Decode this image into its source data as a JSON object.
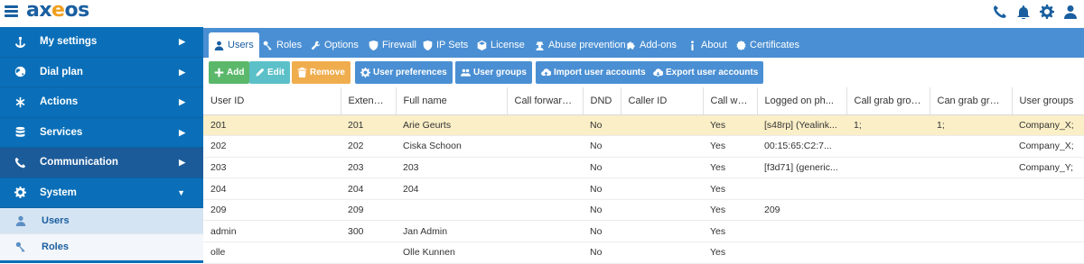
{
  "app": {
    "logo_main": "ax",
    "logo_accent": "e",
    "logo_rest": "os"
  },
  "sidebar": {
    "items": [
      {
        "label": "My settings",
        "icon": "anchor-icon"
      },
      {
        "label": "Dial plan",
        "icon": "globe-icon"
      },
      {
        "label": "Actions",
        "icon": "asterisk-icon"
      },
      {
        "label": "Services",
        "icon": "database-icon"
      },
      {
        "label": "Communication",
        "icon": "phone-icon"
      },
      {
        "label": "System",
        "icon": "gear-icon"
      }
    ],
    "subitems": [
      {
        "label": "Users",
        "icon": "users-icon"
      },
      {
        "label": "Roles",
        "icon": "key-icon"
      }
    ]
  },
  "tabs": [
    {
      "label": "Users"
    },
    {
      "label": "Roles"
    },
    {
      "label": "Options"
    },
    {
      "label": "Firewall"
    },
    {
      "label": "IP Sets"
    },
    {
      "label": "License"
    },
    {
      "label": "Abuse prevention"
    },
    {
      "label": "Add-ons"
    },
    {
      "label": "About"
    },
    {
      "label": "Certificates"
    }
  ],
  "toolbar": {
    "add": "Add",
    "edit": "Edit",
    "remove": "Remove",
    "user_preferences": "User preferences",
    "user_groups": "User groups",
    "import": "Import user accounts",
    "export": "Export user accounts"
  },
  "table": {
    "headers": [
      "User ID",
      "Extension",
      "Full name",
      "Call forwarding",
      "DND",
      "Caller ID",
      "Call waiting",
      "Logged on ph...",
      "Call grab group",
      "Can grab group",
      "User groups"
    ],
    "rows": [
      [
        "201",
        "201",
        "Arie Geurts",
        "",
        "No",
        "",
        "Yes",
        "[s48rp] (Yealink...",
        "1;",
        "1;",
        "Company_X;"
      ],
      [
        "202",
        "202",
        "Ciska Schoon",
        "",
        "No",
        "",
        "Yes",
        "00:15:65:C2:7...",
        "",
        "",
        "Company_X;"
      ],
      [
        "203",
        "203",
        "203",
        "",
        "No",
        "",
        "Yes",
        "[f3d71] (generic...",
        "",
        "",
        "Company_Y;"
      ],
      [
        "204",
        "204",
        "204",
        "",
        "No",
        "",
        "Yes",
        "",
        "",
        "",
        ""
      ],
      [
        "209",
        "209",
        "",
        "",
        "No",
        "",
        "Yes",
        "209",
        "",
        "",
        ""
      ],
      [
        "admin",
        "300",
        "Jan Admin",
        "",
        "No",
        "",
        "Yes",
        "",
        "",
        "",
        ""
      ],
      [
        "olle",
        "",
        "Olle Kunnen",
        "",
        "No",
        "",
        "Yes",
        "",
        "",
        "",
        ""
      ]
    ]
  },
  "colors": {
    "brand": "#1a5fa0",
    "accent": "#f0a020",
    "sidebar": "#0a6fb8",
    "tabbar": "#4a8fd3",
    "selected_row": "#fbefc7"
  }
}
